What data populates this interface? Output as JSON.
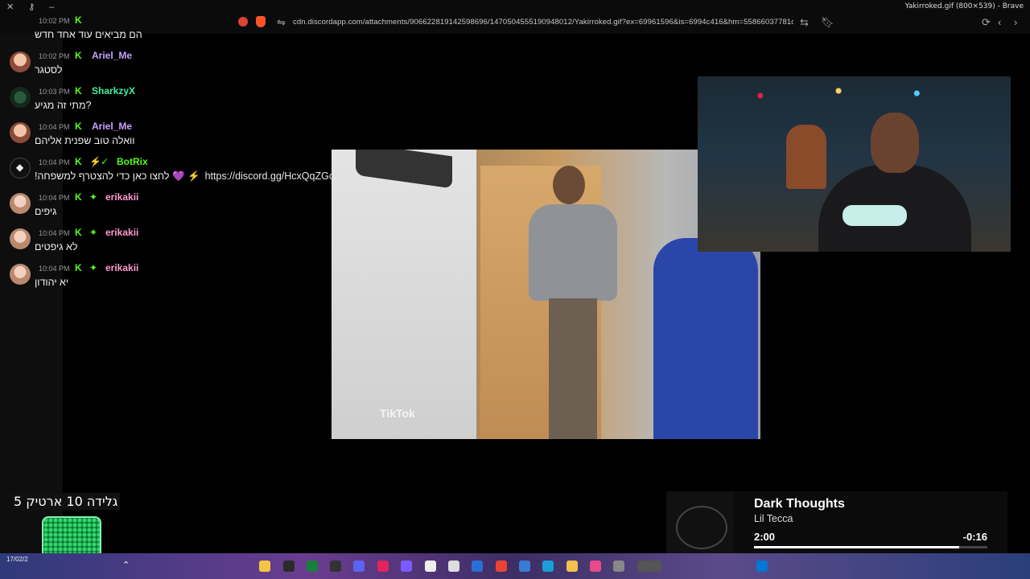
{
  "browser": {
    "window_title": "Yakirroked.gif (800×539) - Brave",
    "url": "cdn.discordapp.com/attachments/906622819142598696/1470504555190948012/Yakirroked.gif?ex=69961596&is=6994c416&hm=55866037781d593..."
  },
  "chat": {
    "messages": [
      {
        "time": "10:02 PM",
        "user": "",
        "user_color": "#b58cff",
        "text": "הם מביאים עוד אחד חדש"
      },
      {
        "time": "10:02 PM",
        "user": "Ariel_Me",
        "user_color": "#c9a0ff",
        "text": "לסטגר"
      },
      {
        "time": "10:03 PM",
        "user": "SharkzyX",
        "user_color": "#3ef0a0",
        "text": "מתי זה מגיע?"
      },
      {
        "time": "10:04 PM",
        "user": "Ariel_Me",
        "user_color": "#c9a0ff",
        "text": "וואלה טוב שפנית אליהם"
      },
      {
        "time": "10:04 PM",
        "user": "BotRix",
        "user_color": "#53fc18",
        "text": "!לחצו כאן כדי להצטרף למשפחה 💜 ⚡",
        "link": "https://discord.gg/HcxQqZGcRH"
      },
      {
        "time": "10:04 PM",
        "user": "erikakii",
        "user_color": "#ff9bd0",
        "text": "גיפים"
      },
      {
        "time": "10:04 PM",
        "user": "erikakii",
        "user_color": "#ff9bd0",
        "text": "לא גיפטים"
      },
      {
        "time": "10:04 PM",
        "user": "erikakii",
        "user_color": "#ff9bd0",
        "text": "יא יהודון"
      }
    ]
  },
  "video": {
    "watermark": "TikTok"
  },
  "overlay": {
    "donation_text": "גלידה 10 ארטיק 5"
  },
  "music": {
    "song": "Dark Thoughts",
    "artist": "Lil Tecca",
    "elapsed": "2:00",
    "remaining": "-0:16",
    "progress": 0.88
  },
  "taskbar": {
    "date": "17/02/2"
  },
  "colors": {
    "kick_green": "#53fc18",
    "background": "#000000"
  }
}
